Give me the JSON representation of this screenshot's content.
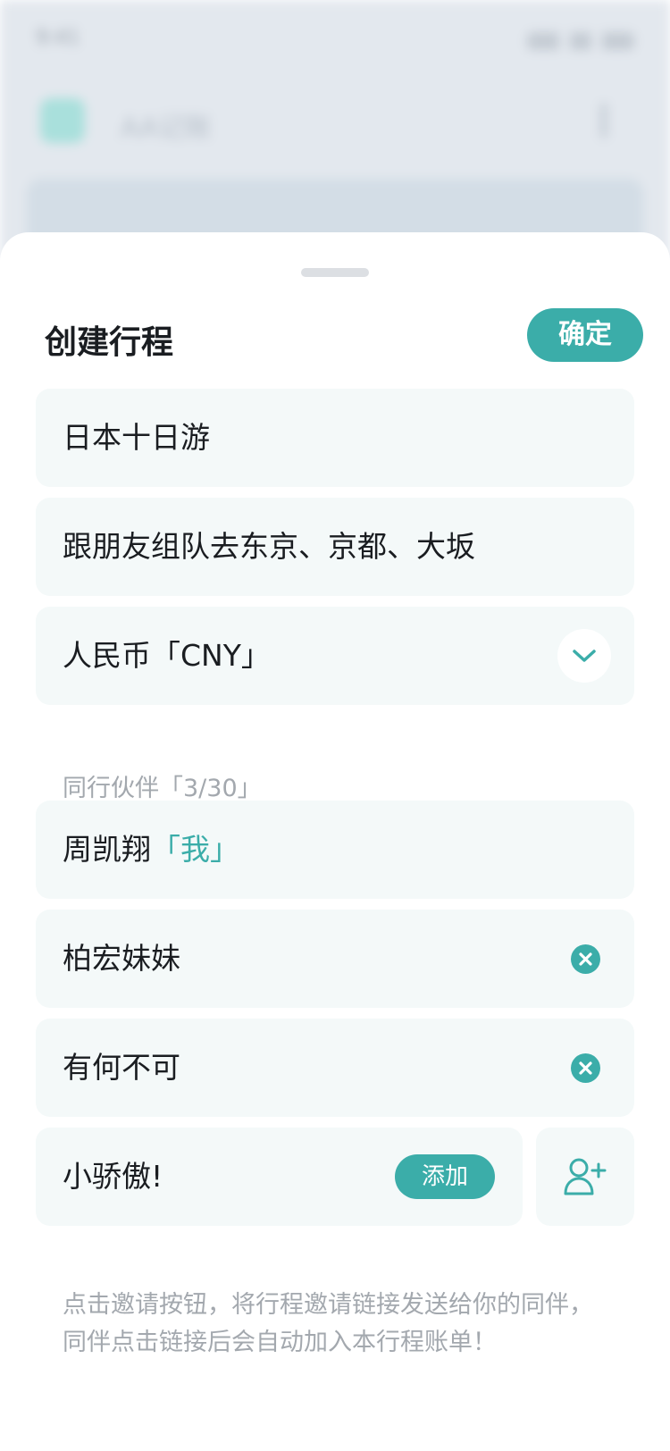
{
  "background": {
    "status_time": "9:41",
    "app_title": "AA记账"
  },
  "sheet": {
    "title": "创建行程",
    "confirm_label": "确定"
  },
  "form": {
    "trip_name": "日本十日游",
    "trip_description": "跟朋友组队去东京、京都、大坂",
    "currency": "人民币「CNY」"
  },
  "companions": {
    "section_label": "同行伙伴「3/30」",
    "members": [
      {
        "name": "周凯翔",
        "tag": "「我」"
      },
      {
        "name": "柏宏妹妹"
      },
      {
        "name": "有何不可"
      }
    ],
    "new_member_value": "小骄傲!",
    "add_label": "添加"
  },
  "hint": "点击邀请按钮，将行程邀请链接发送给你的同伴，同伴点击链接后会自动加入本行程账单！",
  "icons": {
    "currency_dropdown": "chevron-down-icon",
    "remove_member": "close-circle-icon",
    "invite": "add-user-icon"
  },
  "colors": {
    "accent": "#3bada9",
    "field_bg": "#f4f9f9",
    "text_primary": "#1a1d21",
    "text_secondary": "#a3a8ae"
  }
}
